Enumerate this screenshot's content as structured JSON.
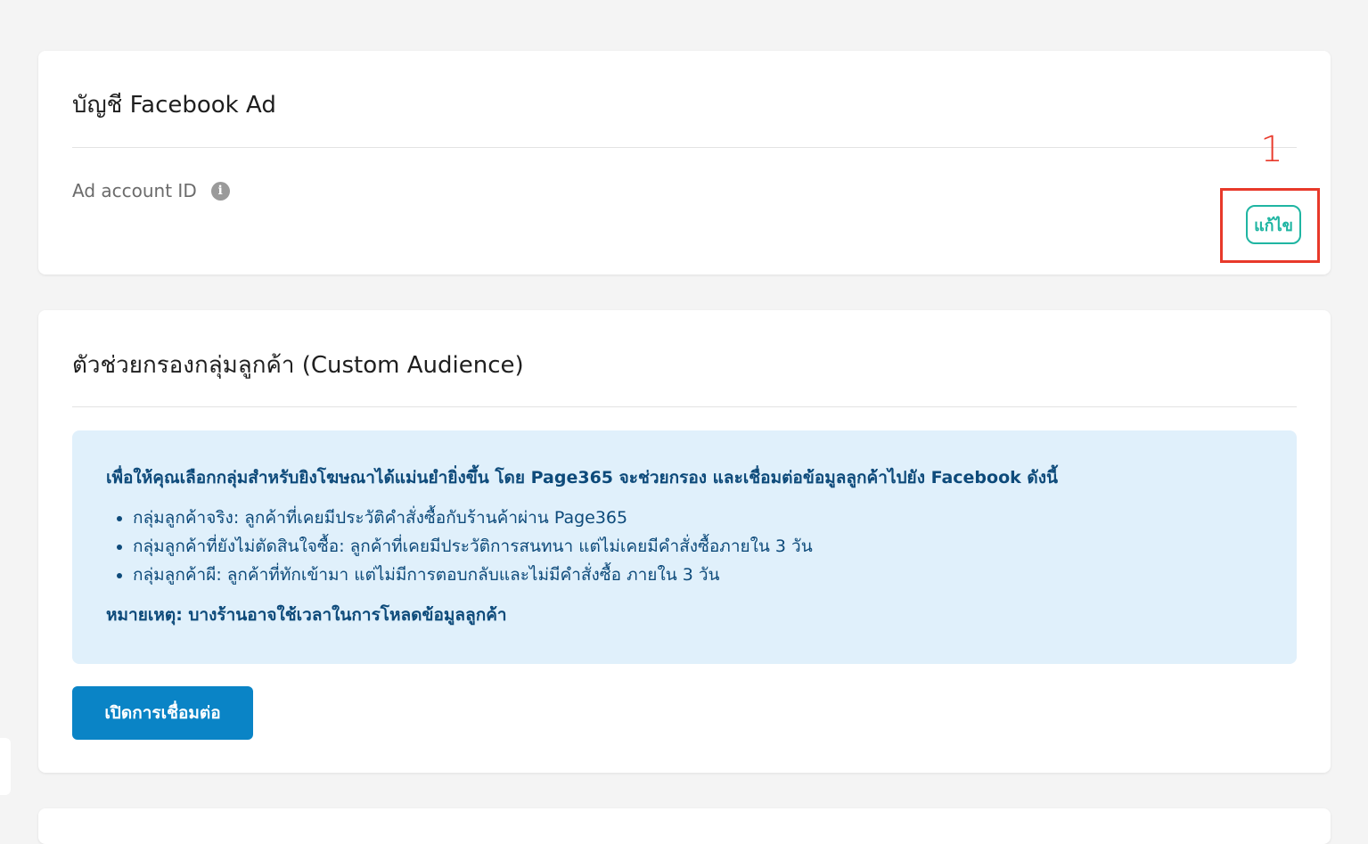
{
  "ad_account_card": {
    "title": "บัญชี Facebook Ad",
    "field_label": "Ad account ID",
    "info_icon": "info-circle-icon",
    "edit_label": "แก้ไข",
    "annotation_number": "1"
  },
  "custom_audience_card": {
    "title": "ตัวช่วยกรองกลุ่มลูกค้า (Custom Audience)",
    "info_box": {
      "lead": "เพื่อให้คุณเลือกกลุ่มสำหรับยิงโฆษณาได้แม่นยำยิ่งขึ้น โดย Page365 จะช่วยกรอง และเชื่อมต่อข้อมูลลูกค้าไปยัง Facebook ดังนี้",
      "items": [
        "กลุ่มลูกค้าจริง: ลูกค้าที่เคยมีประวัติคำสั่งซื้อกับร้านค้าผ่าน Page365",
        "กลุ่มลูกค้าที่ยังไม่ตัดสินใจซื้อ: ลูกค้าที่เคยมีประวัติการสนทนา แต่ไม่เคยมีคำสั่งซื้อภายใน 3 วัน",
        "กลุ่มลูกค้าผี: ลูกค้าที่ทักเข้ามา แต่ไม่มีการตอบกลับและไม่มีคำสั่งซื้อ ภายใน 3 วัน"
      ],
      "note": "หมายเหตุ: บางร้านอาจใช้เวลาในการโหลดข้อมูลลูกค้า"
    },
    "connect_label": "เปิดการเชื่อมต่อ"
  },
  "colors": {
    "accent_teal": "#1fb5a2",
    "primary_blue": "#0a84c6",
    "annotation_red": "#e8392a",
    "info_bg": "#e0f0fb",
    "info_text": "#0d4a7a"
  }
}
